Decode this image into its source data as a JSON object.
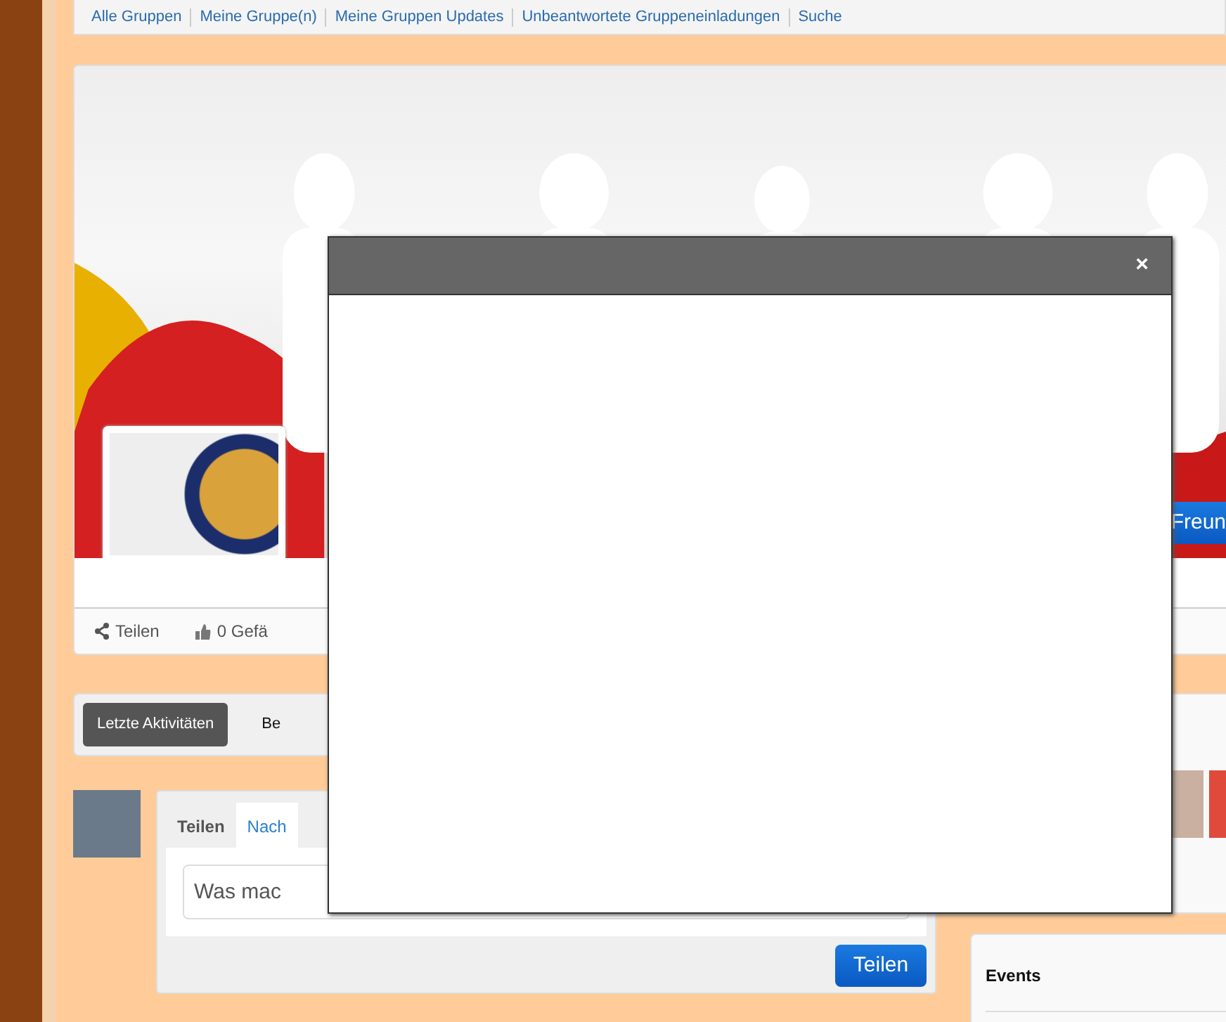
{
  "top_nav": {
    "links": [
      "Alle Gruppen",
      "Meine Gruppe(n)",
      "Meine Gruppen Updates",
      "Unbeantwortete Gruppeneinladungen",
      "Suche"
    ]
  },
  "cover": {
    "add_friend_button": "Freun"
  },
  "actions": [
    {
      "kind": "share",
      "label": "Teilen"
    },
    {
      "kind": "like",
      "label": "0 Gefä"
    }
  ],
  "activity_tabs": [
    {
      "label": "Letzte Aktivitäten",
      "selected": true
    },
    {
      "label": "Be",
      "selected": false
    }
  ],
  "composer": {
    "tabs": [
      {
        "label": "Teilen",
        "selected": true
      },
      {
        "label": "Nach",
        "selected": false
      }
    ],
    "placeholder": "Was mac",
    "submit": "Teilen"
  },
  "events": {
    "title": "Events"
  },
  "modal": {
    "close": "×"
  }
}
